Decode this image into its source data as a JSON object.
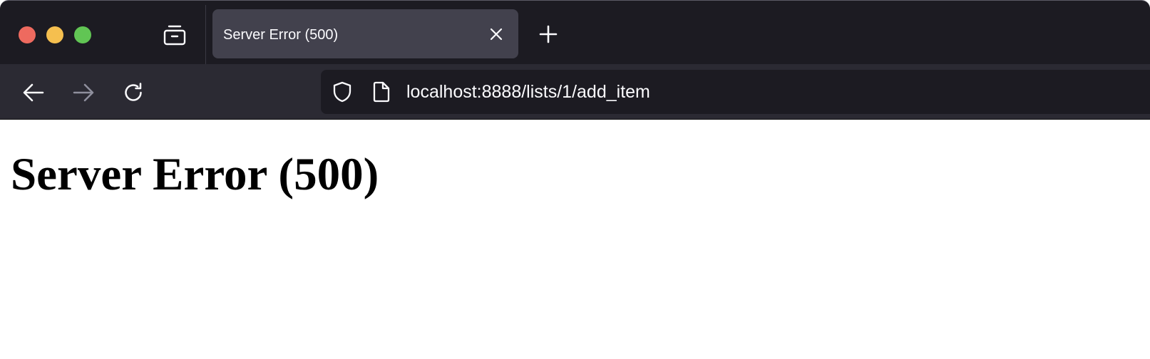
{
  "window": {
    "controls": [
      "close",
      "minimize",
      "maximize"
    ],
    "colors": {
      "close": "#ee6a5f",
      "minimize": "#f5bf4f",
      "maximize": "#61c554",
      "tabstrip_bg": "#1c1b22",
      "active_tab_bg": "#42414d",
      "navbar_bg": "#2b2a33",
      "urlbar_bg": "#1c1b22"
    }
  },
  "tabstrip": {
    "tabs_list_icon": "tabs-list-icon",
    "tabs": [
      {
        "title": "Server Error (500)",
        "active": true,
        "close_icon": "close-icon"
      }
    ],
    "new_tab_icon": "plus-icon"
  },
  "navbar": {
    "back_icon": "arrow-left-icon",
    "forward_icon": "arrow-right-icon",
    "forward_enabled": false,
    "reload_icon": "reload-icon",
    "urlbar": {
      "security_icon": "shield-icon",
      "page_icon": "page-icon",
      "url": "localhost:8888/lists/1/add_item"
    }
  },
  "page": {
    "heading": "Server Error (500)"
  }
}
